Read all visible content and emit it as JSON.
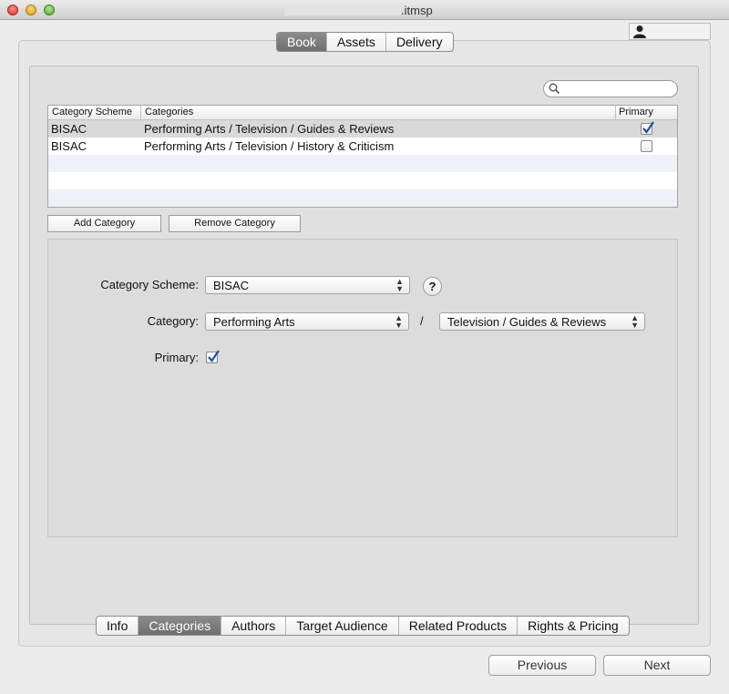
{
  "window": {
    "title": ".itmsp"
  },
  "top_tabs": [
    {
      "label": "Book",
      "active": true
    },
    {
      "label": "Assets",
      "active": false
    },
    {
      "label": "Delivery",
      "active": false
    }
  ],
  "search": {
    "placeholder": "",
    "icon": "magnifier-icon"
  },
  "table": {
    "columns": [
      "Category Scheme",
      "Categories",
      "Primary"
    ],
    "rows": [
      {
        "scheme": "BISAC",
        "category": "Performing Arts / Television / Guides & Reviews",
        "primary": true
      },
      {
        "scheme": "BISAC",
        "category": "Performing Arts / Television / History & Criticism",
        "primary": false
      }
    ]
  },
  "buttons": {
    "add": "Add Category",
    "remove": "Remove Category"
  },
  "detail": {
    "scheme_label": "Category Scheme:",
    "scheme_value": "BISAC",
    "help": "?",
    "category_label": "Category:",
    "category_value": "Performing Arts",
    "separator": "/",
    "subcategory_value": "Television / Guides & Reviews",
    "primary_label": "Primary:",
    "primary_checked": true
  },
  "bottom_tabs": [
    {
      "label": "Info",
      "active": false
    },
    {
      "label": "Categories",
      "active": true
    },
    {
      "label": "Authors",
      "active": false
    },
    {
      "label": "Target Audience",
      "active": false
    },
    {
      "label": "Related Products",
      "active": false
    },
    {
      "label": "Rights & Pricing",
      "active": false
    }
  ],
  "nav": {
    "previous": "Previous",
    "next": "Next"
  },
  "colors": {
    "active_tab": "#7c7c7c",
    "check": "#1f5fbf"
  }
}
